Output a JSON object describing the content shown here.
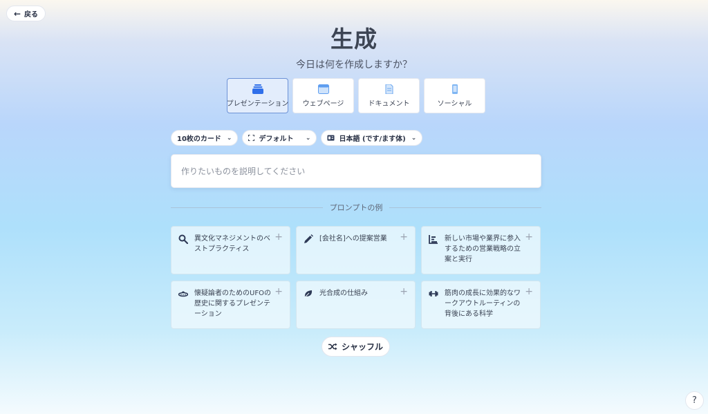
{
  "back_label": "戻る",
  "title": "生成",
  "subtitle": "今日は何を作成しますか？",
  "types": [
    {
      "label": "プレゼンテーション",
      "icon": "presentation-icon",
      "selected": true
    },
    {
      "label": "ウェブページ",
      "icon": "webpage-icon",
      "selected": false
    },
    {
      "label": "ドキュメント",
      "icon": "document-icon",
      "selected": false
    },
    {
      "label": "ソーシャル",
      "icon": "social-icon",
      "selected": false
    }
  ],
  "filters": {
    "cards": "10枚のカード",
    "theme": "デフォルト",
    "language": "日本語 (です/ます体)"
  },
  "prompt": {
    "placeholder": "作りたいものを説明してください"
  },
  "examples_heading": "プロンプトの例",
  "examples": [
    {
      "text": "異文化マネジメントのベストプラクティス",
      "icon": "search-icon"
    },
    {
      "text": "[会社名]への提案営業",
      "icon": "pencil-icon"
    },
    {
      "text": "新しい市場や業界に参入するための営業戦略の立案と実行",
      "icon": "chart-bars-icon"
    },
    {
      "text": "懐疑論者のためのUFOの歴史に関するプレゼンテーション",
      "icon": "ufo-icon"
    },
    {
      "text": "光合成の仕組み",
      "icon": "leaf-icon"
    },
    {
      "text": "筋肉の成長に効果的なワークアウトルーティンの背後にある科学",
      "icon": "dumbbell-icon"
    }
  ],
  "plus_symbol": "+",
  "shuffle_label": "シャッフル",
  "help_label": "?",
  "colors": {
    "accent": "#2f6fea",
    "selected_bg": "#e3edfc",
    "selected_border": "#6d92d6"
  }
}
